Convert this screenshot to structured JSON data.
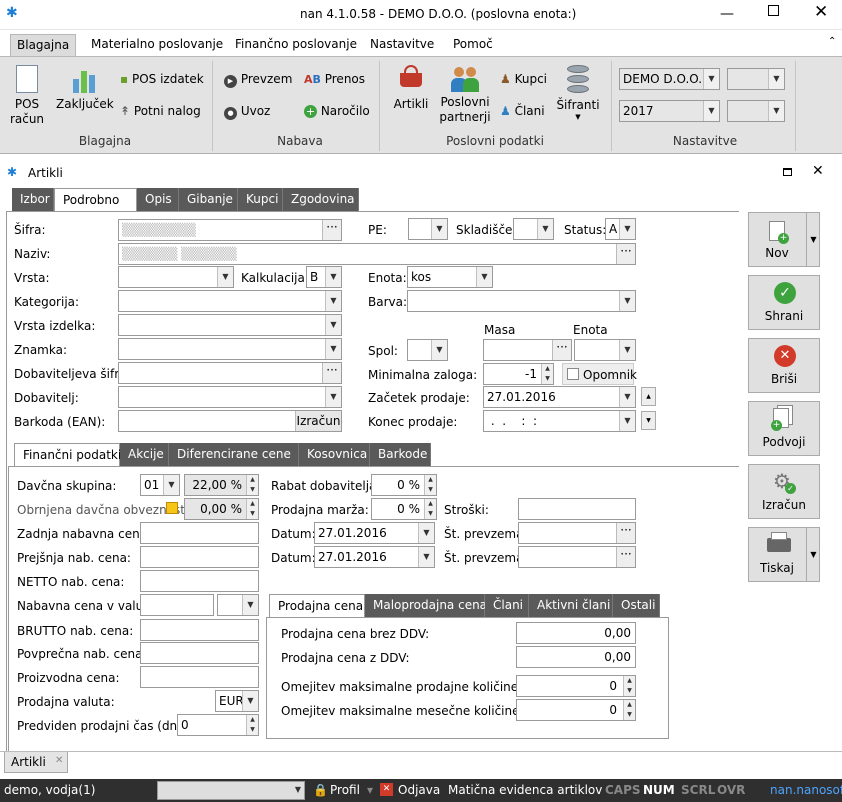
{
  "window": {
    "title": "nan 4.1.0.58 - DEMO D.O.O. (poslovna enota:)"
  },
  "menu": {
    "tabs": [
      "Blagajna",
      "Materialno poslovanje",
      "Finančno poslovanje",
      "Nastavitve",
      "Pomoč"
    ]
  },
  "ribbon": {
    "blagajna": {
      "pos_racun": "POS\nračun",
      "zakljucek": "Zaključek",
      "pos_izdatek": "POS izdatek",
      "potni_nalog": "Potni nalog",
      "label": "Blagajna"
    },
    "nabava": {
      "prevzem": "Prevzem",
      "uvoz": "Uvoz",
      "prenos": "Prenos",
      "narocilo": "Naročilo",
      "label": "Nabava"
    },
    "poslovni": {
      "artikli": "Artikli",
      "partnerji": "Poslovni\npartnerji",
      "kupci": "Kupci",
      "clani": "Člani",
      "sifranti": "Šifranti",
      "label": "Poslovni podatki"
    },
    "nastavitve": {
      "company": "DEMO D.O.O.",
      "year": "2017",
      "label": "Nastavitve"
    }
  },
  "doc": {
    "title": "Artikli"
  },
  "tabs": [
    "Izbor",
    "Podrobno",
    "Opis",
    "Gibanje",
    "Kupci",
    "Zgodovina"
  ],
  "form": {
    "sifra_label": "Šifra:",
    "naziv_label": "Naziv:",
    "vrsta_label": "Vrsta:",
    "kalkulacija_label": "Kalkulacija:",
    "kalkulacija_value": "B",
    "kategorija_label": "Kategorija:",
    "vrsta_izdelka_label": "Vrsta izdelka:",
    "znamka_label": "Znamka:",
    "dob_sifra_label": "Dobaviteljeva šifra:",
    "dobavitelj_label": "Dobavitelj:",
    "barkoda_label": "Barkoda (EAN):",
    "izracun": "Izračun",
    "pe_label": "PE:",
    "skladisce_label": "Skladišče:",
    "status_label": "Status:",
    "status_value": "A",
    "enota_label": "Enota:",
    "enota_value": "kos",
    "barva_label": "Barva:",
    "masa_label": "Masa",
    "enota2_label": "Enota",
    "spol_label": "Spol:",
    "min_zaloga_label": "Minimalna zaloga:",
    "min_zaloga_value": "-1",
    "opomnik": "Opomnik",
    "zacetek_label": "Začetek prodaje:",
    "zacetek_value": "27.01.2016",
    "konec_label": "Konec prodaje:",
    "konec_value": " .  .    :  :"
  },
  "subtabs": [
    "Finančni podatki",
    "Akcije",
    "Diferencirane cene",
    "Kosovnica",
    "Barkode"
  ],
  "fin": {
    "davcna_label": "Davčna skupina:",
    "davcna_value": "01",
    "davcna_pct": "22,00 %",
    "obrnjena_label": "Obrnjena davčna obveznost",
    "obrnjena_pct": "0,00 %",
    "zadnja_label": "Zadnja nabavna cena:",
    "prejsnja_label": "Prejšnja nab. cena:",
    "netto_label": "NETTO nab. cena:",
    "valuta_label": "Nabavna cena v valuti:",
    "brutto_label": "BRUTTO nab. cena:",
    "povprecna_label": "Povprečna nab. cena:",
    "proizvodna_label": "Proizvodna cena:",
    "prodajna_valuta_label": "Prodajna valuta:",
    "prodajna_valuta_value": "EUR",
    "predviden_label": "Predviden prodajni čas (dni):",
    "predviden_value": "0",
    "rabat_label": "Rabat dobavitelja:",
    "rabat_value": "0 %",
    "marza_label": "Prodajna marža:",
    "marza_value": "0 %",
    "stroski_label": "Stroški:",
    "datum_label": "Datum:",
    "datum1": "27.01.2016",
    "datum2": "27.01.2016",
    "prevzema_label": "Št. prevzema:"
  },
  "pricetabs": [
    "Prodajna cena",
    "Maloprodajna cena",
    "Člani",
    "Aktivni člani",
    "Ostali"
  ],
  "price": {
    "brez_label": "Prodajna cena brez DDV:",
    "brez_value": "0,00",
    "z_label": "Prodajna cena z DDV:",
    "z_value": "0,00",
    "omejitev1_label": "Omejitev maksimalne prodajne količine:",
    "omejitev1_value": "0",
    "omejitev2_label": "Omejitev maksimalne mesečne količine:",
    "omejitev2_value": "0"
  },
  "side": {
    "nov": "Nov",
    "shrani": "Shrani",
    "brisi": "Briši",
    "podvoji": "Podvoji",
    "izracun": "Izračun",
    "tiskaj": "Tiskaj"
  },
  "doctab": {
    "label": "Artikli"
  },
  "status": {
    "user": "demo, vodja(1)",
    "profil": "Profil",
    "odjava": "Odjava",
    "module": "Matična evidenca artiklov",
    "caps": "CAPS",
    "num": "NUM",
    "scrl": "SCRL",
    "ovr": "OVR",
    "brand": "nan.nanosoft"
  },
  "colors": {
    "statusbar": "#2f2f2f",
    "tab_dark": "#5a5a5a",
    "ribbon": "#e3e3e3",
    "brand": "#4ea3ff"
  }
}
